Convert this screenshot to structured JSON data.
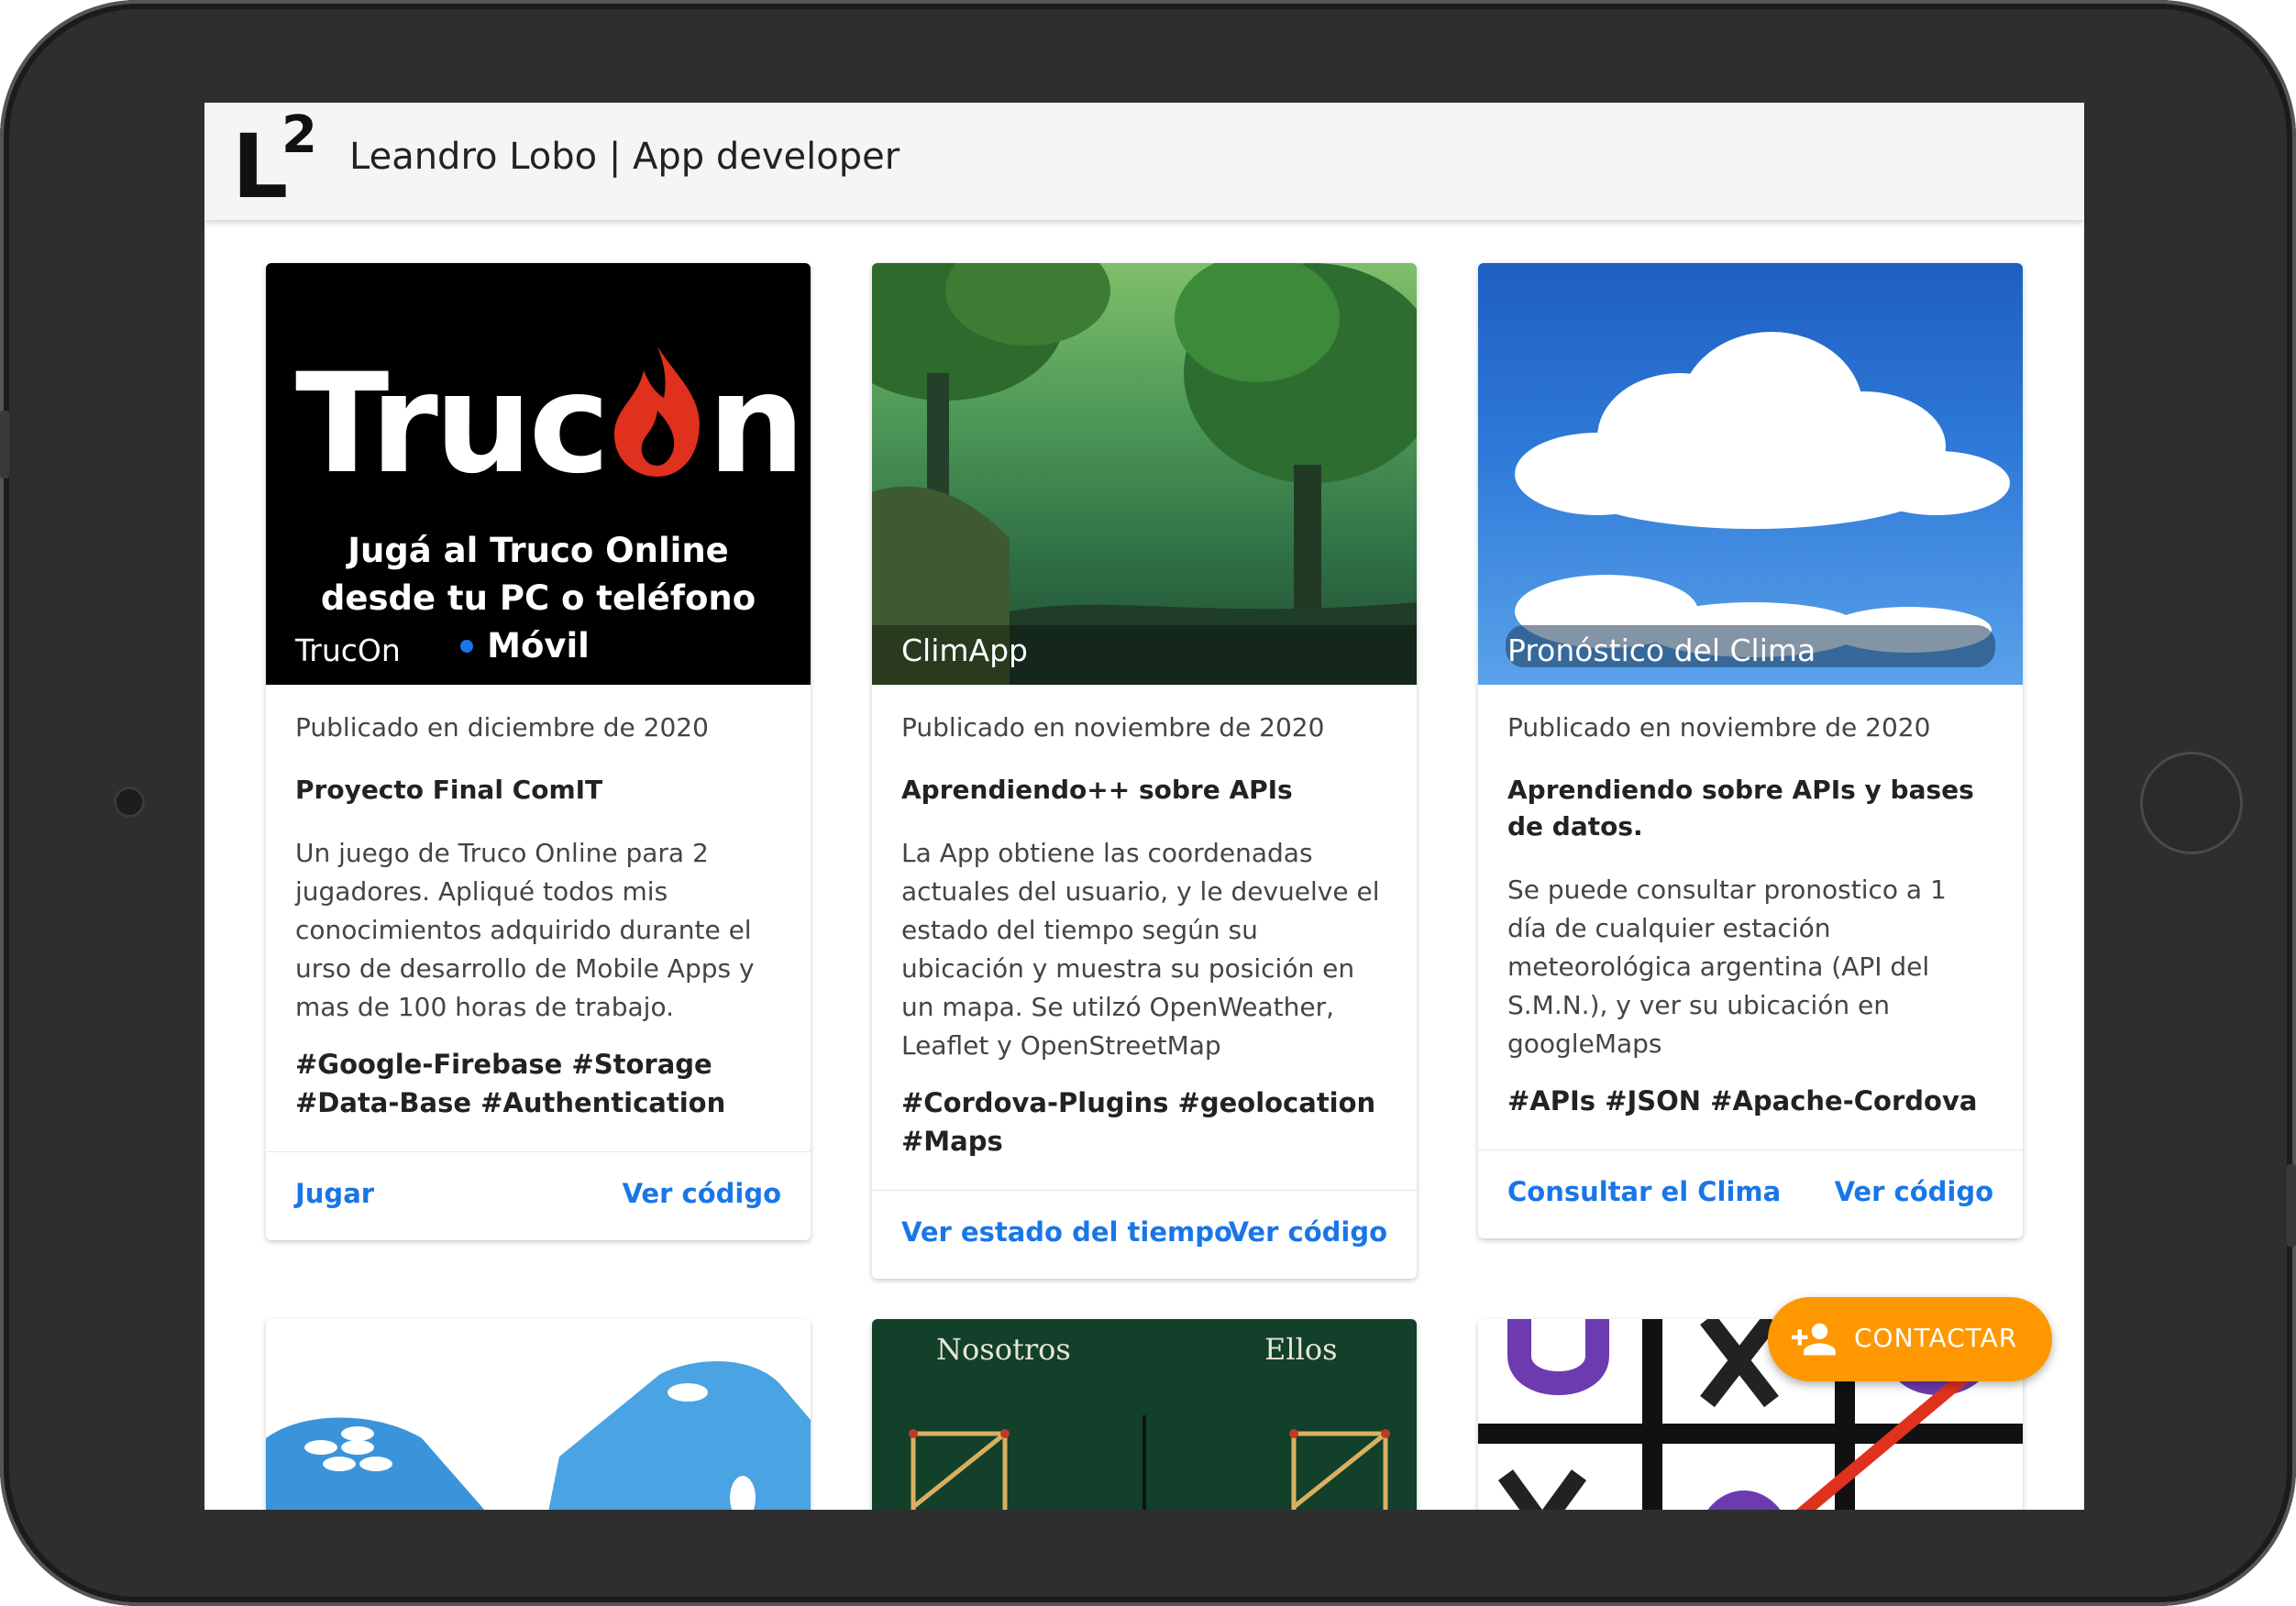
{
  "header": {
    "logo_letter": "L",
    "logo_superscript": "2",
    "title": "Leandro Lobo | App developer"
  },
  "cards": [
    {
      "media": {
        "title": "TrucOn",
        "brand_a": "Truc",
        "brand_b": "n",
        "tagline_1": "Jugá al Truco Online",
        "tagline_2": "desde tu PC o teléfono Móvil"
      },
      "published": "Publicado en diciembre de 2020",
      "subtitle": "Proyecto Final ComIT",
      "description": "Un juego de Truco Online para 2 jugadores. Apliqué todos mis conocimientos adquirido durante el urso de desarrollo de Mobile Apps y mas de 100 horas de trabajo.",
      "tags": "#Google-Firebase #Storage #Data-Base #Authentication",
      "action_primary": "Jugar",
      "action_secondary": "Ver código"
    },
    {
      "media": {
        "title": "ClimApp"
      },
      "published": "Publicado en noviembre de 2020",
      "subtitle": "Aprendiendo++ sobre APIs",
      "description": "La App obtiene las coordenadas actuales del usuario, y le devuelve el estado del tiempo según su ubicación y muestra su posición en un mapa. Se utilzó OpenWeather, Leaflet y OpenStreetMap",
      "tags": "#Cordova-Plugins #geolocation #Maps",
      "action_primary": "Ver estado del tiempo",
      "action_secondary": "Ver código"
    },
    {
      "media": {
        "title": "Pronóstico del Clima"
      },
      "published": "Publicado en noviembre de 2020",
      "subtitle": "Aprendiendo sobre APIs y bases de datos.",
      "description": "Se puede consultar pronostico a 1 día de cualquier estación meteorológica argentina (API del S.M.N.), y ver su ubicación en googleMaps",
      "tags": "#APIs #JSON #Apache-Cordova",
      "action_primary": "Consultar el Clima",
      "action_secondary": "Ver código"
    }
  ],
  "partial_cards": {
    "truco_score_left": "Nosotros",
    "truco_score_right": "Ellos"
  },
  "fab": {
    "label": "CONTACTAR",
    "icon": "person-add-icon"
  },
  "colors": {
    "link": "#1976e8",
    "fab": "#ff9800",
    "appbar": "#f5f5f5",
    "flame": "#e0301e"
  }
}
